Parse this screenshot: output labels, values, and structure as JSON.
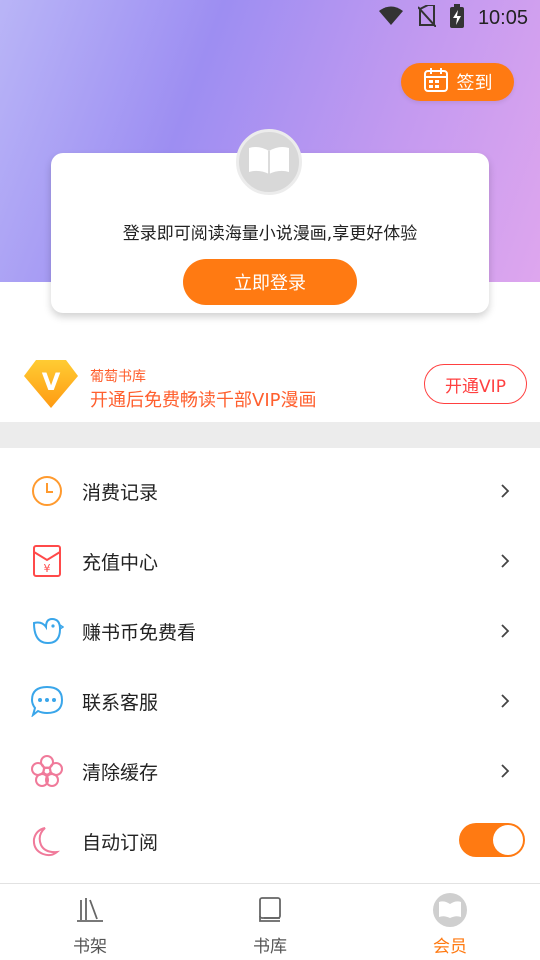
{
  "status_bar": {
    "time": "10:05",
    "icons": [
      "wifi-icon",
      "no-sim-icon",
      "battery-charging-icon"
    ]
  },
  "header": {
    "signin_label": "签到",
    "signin_icon": "calendar-icon"
  },
  "login_card": {
    "avatar_icon": "book-open-icon",
    "message": "登录即可阅读海量小说漫画,享更好体验",
    "button_label": "立即登录"
  },
  "vip": {
    "badge_letter": "V",
    "title": "葡萄书库",
    "subtitle": "开通后免费畅读千部VIP漫画",
    "button_label": "开通VIP"
  },
  "menu": [
    {
      "label": "消费记录",
      "icon": "clock-icon"
    },
    {
      "label": "充值中心",
      "icon": "red-envelope-icon"
    },
    {
      "label": "赚书币免费看",
      "icon": "bird-icon"
    },
    {
      "label": "联系客服",
      "icon": "chat-bubble-icon"
    },
    {
      "label": "清除缓存",
      "icon": "flower-icon"
    },
    {
      "label": "自动订阅",
      "icon": "moon-icon",
      "toggle": true,
      "toggle_on": true
    }
  ],
  "bottom_nav": [
    {
      "label": "书架",
      "icon": "bookshelf-icon",
      "active": false
    },
    {
      "label": "书库",
      "icon": "library-icon",
      "active": false
    },
    {
      "label": "会员",
      "icon": "member-icon",
      "active": true
    }
  ],
  "colors": {
    "accent": "#ff7a12",
    "vip_red": "#ff4040",
    "header_gradient": [
      "#b9b5f7",
      "#9d8ef2",
      "#dea6ee"
    ]
  }
}
